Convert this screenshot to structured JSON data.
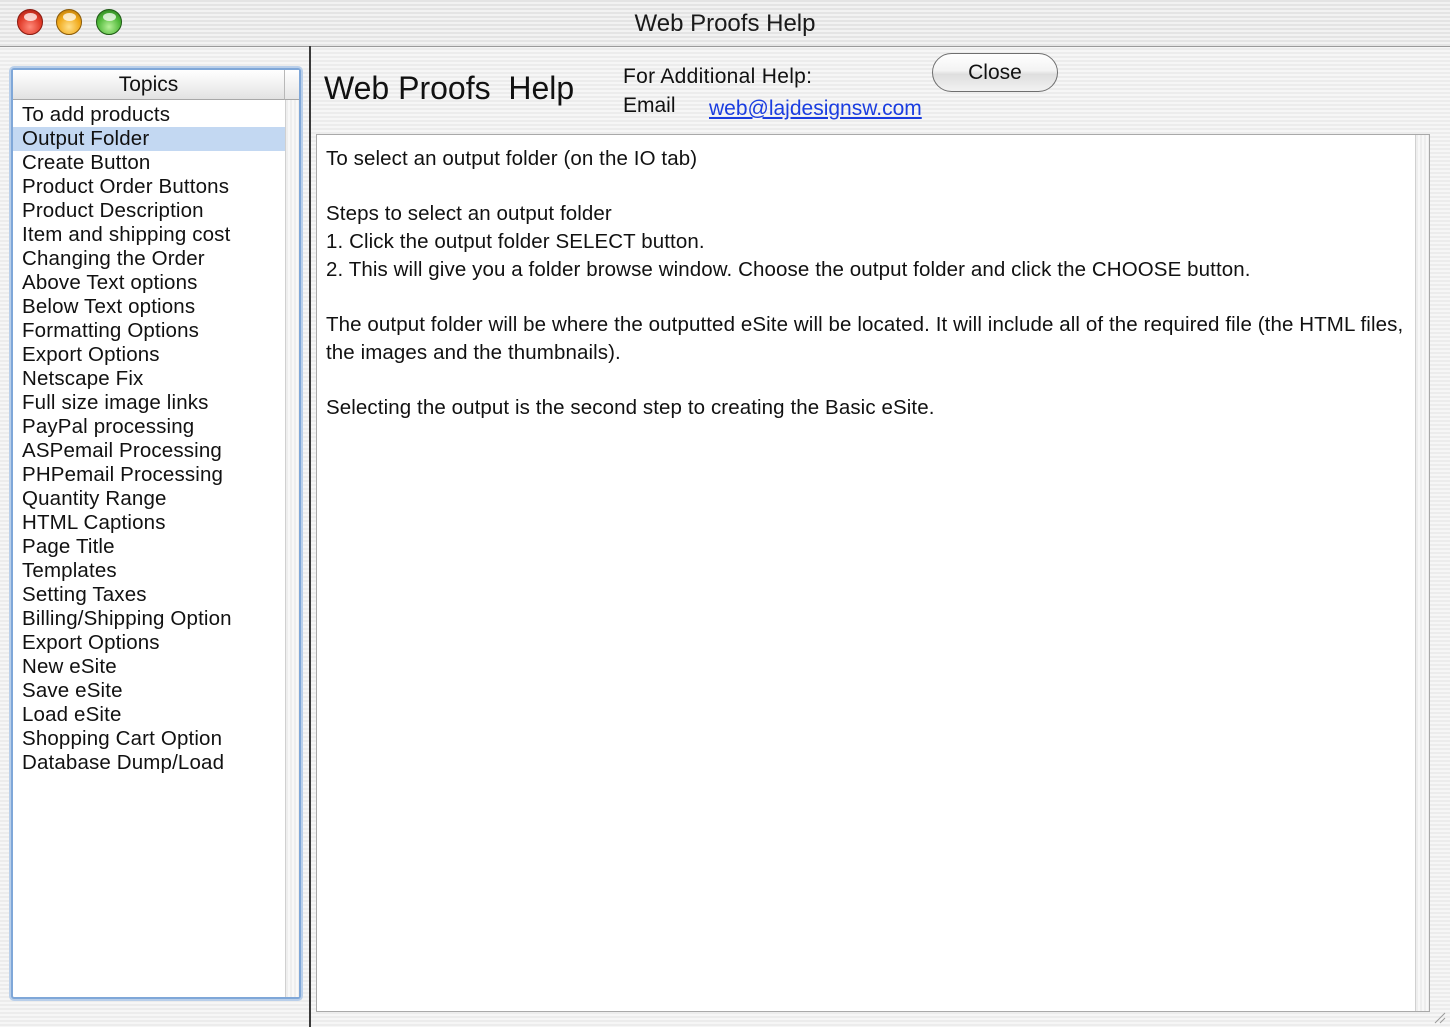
{
  "window": {
    "title": "Web Proofs Help"
  },
  "topics": {
    "header": "Topics",
    "selected_index": 1,
    "items": [
      "To add products",
      "Output Folder",
      "Create Button",
      "Product Order Buttons",
      "Product Description",
      "Item and shipping cost",
      "Changing the Order",
      "Above Text options",
      "Below Text options",
      "Formatting Options",
      "Export Options",
      "Netscape Fix",
      "Full size image links",
      "PayPal processing",
      "ASPemail Processing",
      "PHPemail Processing",
      "Quantity Range",
      "HTML Captions",
      "Page Title",
      "Templates",
      "Setting Taxes",
      "Billing/Shipping Option",
      "Export Options",
      "New eSite",
      "Save eSite",
      "Load eSite",
      "Shopping Cart Option",
      "Database Dump/Load"
    ]
  },
  "header": {
    "title": "Web Proofs  Help",
    "additional_help_label": "For Additional Help:",
    "email_label": "Email",
    "email_link": "web@lajdesignsw.com",
    "close_label": "Close"
  },
  "content": {
    "line1": "To select an output folder (on the IO tab)",
    "line2": "Steps to select an output folder",
    "line3": "1. Click the output folder SELECT button.",
    "line4": "2. This will give you a folder browse window. Choose the output folder and click the CHOOSE button.",
    "line5": "The output folder will be where the outputted eSite will be located. It will include all of the required file (the HTML files, the images and the thumbnails).",
    "line6": "Selecting the output is the second step to creating the Basic eSite."
  },
  "colors": {
    "selection": "#c3d8f2",
    "link": "#1a3de0",
    "focus_ring": "#7fa7d8"
  }
}
